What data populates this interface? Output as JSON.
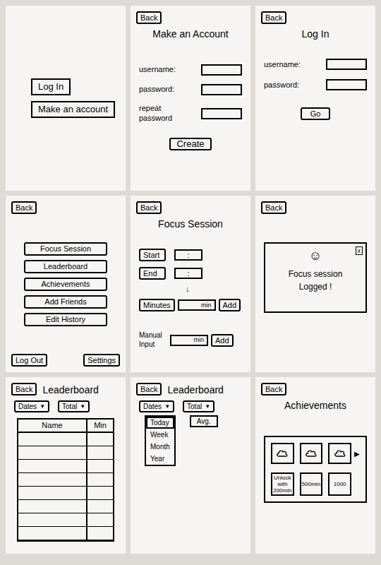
{
  "welcome": {
    "buttons": [
      "Log In",
      "Make an account"
    ]
  },
  "signup": {
    "back": "Back",
    "title": "Make an Account",
    "fields": [
      {
        "label": "username:"
      },
      {
        "label": "password:"
      },
      {
        "label": "repeat password"
      }
    ],
    "button": "Create"
  },
  "login": {
    "back": "Back",
    "title": "Log In",
    "fields": [
      {
        "label": "username:"
      },
      {
        "label": "password:"
      }
    ],
    "button": "Go"
  },
  "menu": {
    "back": "Back",
    "items": [
      "Focus Session",
      "Leaderboard",
      "Achievements",
      "Add Friends",
      "Edit History"
    ],
    "footer": [
      "Log Out",
      "Settings"
    ]
  },
  "focus": {
    "back": "Back",
    "title": "Focus Session",
    "rows": [
      {
        "label": "Start",
        "value": ":"
      },
      {
        "label": "End",
        "value": ":"
      }
    ],
    "arrow": "↓",
    "minutes": {
      "label": "Minutes",
      "unit": "min",
      "button": "Add"
    },
    "manual": {
      "label": "Manual Input",
      "unit": "min",
      "button": "Add"
    }
  },
  "logged": {
    "back": "Back",
    "icon": "☺",
    "close": "x",
    "message": "Focus session Logged !"
  },
  "leaderboard": {
    "back": "Back",
    "title": "Leaderboard",
    "filters": [
      {
        "label": "Dates",
        "arrow": "▼"
      },
      {
        "label": "Total",
        "arrow": "▼"
      }
    ],
    "columns": [
      "Name",
      "Min"
    ],
    "rows": [
      [
        "",
        ""
      ],
      [
        "",
        ""
      ],
      [
        "",
        ""
      ],
      [
        "",
        ""
      ],
      [
        "",
        ""
      ],
      [
        "",
        ""
      ],
      [
        "",
        ""
      ],
      [
        "",
        ""
      ]
    ]
  },
  "leaderboard_open": {
    "back": "Back",
    "title": "Leaderboard",
    "filters": [
      {
        "label": "Dates",
        "arrow": "▼"
      },
      {
        "label": "Total",
        "arrow": "▼"
      }
    ],
    "date_options": [
      {
        "label": "Today",
        "selected": true
      },
      {
        "label": "Week",
        "selected": false
      },
      {
        "label": "Month",
        "selected": false
      },
      {
        "label": "Year",
        "selected": false
      }
    ],
    "total_options": [
      {
        "label": "Avg.",
        "selected": false
      }
    ]
  },
  "achievements": {
    "back": "Back",
    "title": "Achievements",
    "next": "▶",
    "badges": [
      {
        "unlocked": true,
        "label": ""
      },
      {
        "unlocked": true,
        "label": ""
      },
      {
        "unlocked": true,
        "label": ""
      },
      {
        "unlocked": false,
        "label": "Unlock with 200min"
      },
      {
        "unlocked": false,
        "label": "500min"
      },
      {
        "unlocked": false,
        "label": "1000"
      }
    ]
  }
}
